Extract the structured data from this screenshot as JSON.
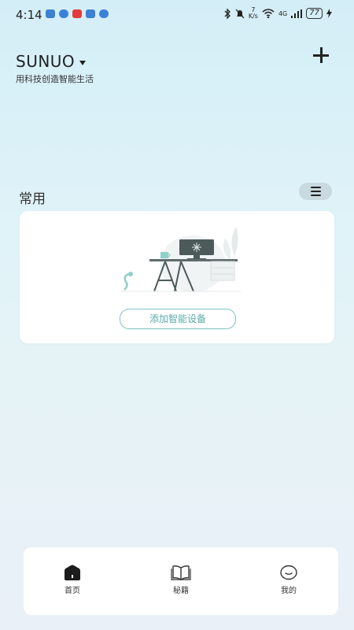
{
  "status_bar": {
    "time": "4:14",
    "app_icons": [
      "mail-icon",
      "message-icon",
      "video-icon",
      "cloud-icon",
      "music-icon"
    ],
    "app_colors": [
      "#3b82d6",
      "#3b82d6",
      "#e23b3b",
      "#3b82d6",
      "#3b82d6"
    ],
    "speed": "7",
    "speed_unit": "K/s",
    "network": "4G",
    "battery": "77"
  },
  "header": {
    "brand": "SUNUO",
    "slogan": "用科技创造智能生活"
  },
  "section": {
    "title": "常用"
  },
  "empty_card": {
    "add_label": "添加智能设备"
  },
  "tabbar": {
    "items": [
      {
        "label": "首页",
        "icon": "home-icon",
        "active": true
      },
      {
        "label": "秘籍",
        "icon": "book-icon",
        "active": false
      },
      {
        "label": "我的",
        "icon": "smiley-icon",
        "active": false
      }
    ]
  },
  "colors": {
    "accent": "#5aaaa8",
    "background_top": "#d4eef7",
    "card": "#ffffff"
  }
}
